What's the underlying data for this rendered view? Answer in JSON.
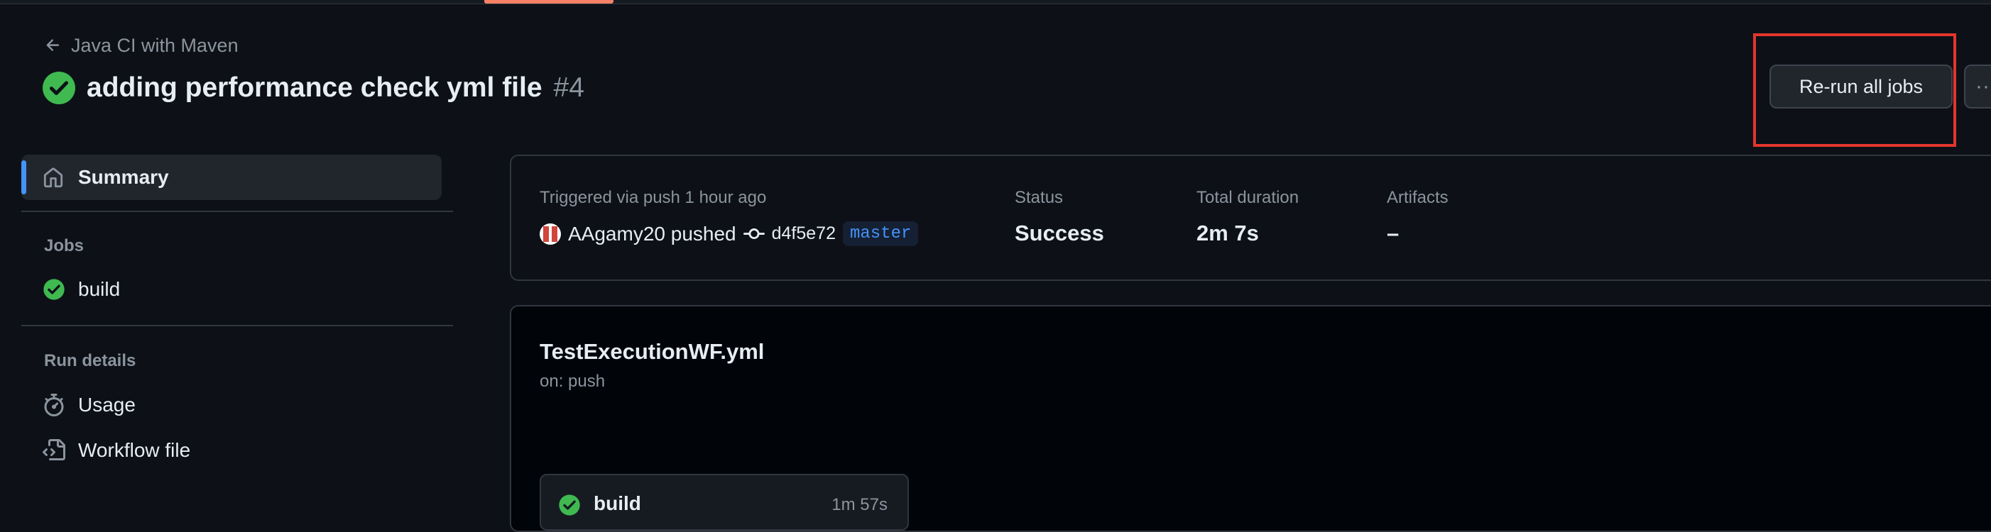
{
  "header": {
    "back_label": "Java CI with Maven",
    "run_title": "adding performance check yml file",
    "run_number": "#4",
    "rerun_label": "Re-run all jobs",
    "more_label": "··"
  },
  "sidebar": {
    "summary_label": "Summary",
    "jobs_heading": "Jobs",
    "jobs": [
      {
        "label": "build"
      }
    ],
    "run_details_heading": "Run details",
    "usage_label": "Usage",
    "workflow_file_label": "Workflow file"
  },
  "summary": {
    "trigger_text": "Triggered via push 1 hour ago",
    "actor_text": "AAgamy20 pushed",
    "commit_sha": "d4f5e72",
    "branch": "master",
    "status_label": "Status",
    "status_value": "Success",
    "duration_label": "Total duration",
    "duration_value": "2m 7s",
    "artifacts_label": "Artifacts",
    "artifacts_value": "–"
  },
  "workflow": {
    "file_name": "TestExecutionWF.yml",
    "trigger": "on: push",
    "job_name": "build",
    "job_duration": "1m 57s"
  },
  "colors": {
    "background": "#0d1117",
    "success": "#3fb950",
    "accent": "#4493f8",
    "highlight_box": "#e5352c",
    "tab_underline": "#f78166"
  },
  "icons": {
    "back": "arrow-left-icon",
    "status": "check-circle-icon",
    "summary": "home-icon",
    "usage": "stopwatch-icon",
    "workflow_file": "file-code-icon",
    "commit": "git-commit-icon"
  }
}
